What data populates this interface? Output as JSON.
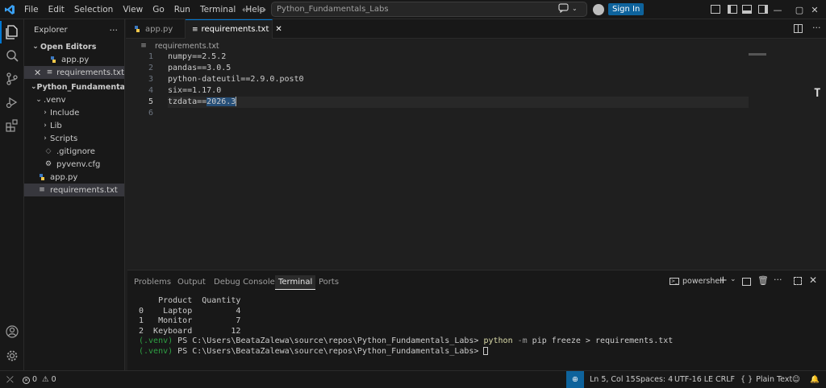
{
  "titlebar": {
    "menus": [
      "File",
      "Edit",
      "Selection",
      "View",
      "Go",
      "Run",
      "Terminal",
      "Help"
    ],
    "search": "Python_Fundamentals_Labs",
    "sign_in": "Sign In"
  },
  "sidebar": {
    "title": "Explorer",
    "open_editors_label": "Open Editors",
    "open_editors": [
      "app.py",
      "requirements.txt"
    ],
    "folder_label": "Python_Fundamentals...",
    "tree": [
      {
        "name": ".venv",
        "kind": "folder-open",
        "indent": 1
      },
      {
        "name": "Include",
        "kind": "folder",
        "indent": 2
      },
      {
        "name": "Lib",
        "kind": "folder",
        "indent": 2
      },
      {
        "name": "Scripts",
        "kind": "folder",
        "indent": 2
      },
      {
        "name": ".gitignore",
        "kind": "file",
        "indent": 2
      },
      {
        "name": "pyvenv.cfg",
        "kind": "gear",
        "indent": 2
      },
      {
        "name": "app.py",
        "kind": "python",
        "indent": 1
      },
      {
        "name": "requirements.txt",
        "kind": "text",
        "indent": 1
      }
    ]
  },
  "tabs": [
    {
      "label": "app.py",
      "active": false
    },
    {
      "label": "requirements.txt",
      "active": true
    }
  ],
  "breadcrumb": "requirements.txt",
  "editor": {
    "lines": [
      {
        "n": "1",
        "text": "numpy==2.5.2"
      },
      {
        "n": "2",
        "text": "pandas==3.0.5"
      },
      {
        "n": "3",
        "text": "python-dateutil==2.9.0.post0"
      },
      {
        "n": "4",
        "text": "six==1.17.0"
      },
      {
        "n": "5",
        "text_a": "tzdata==",
        "text_b": "2026.3"
      },
      {
        "n": "6",
        "text": ""
      }
    ]
  },
  "panel": {
    "tabs": [
      "Problems",
      "Output",
      "Debug Console",
      "Terminal",
      "Ports"
    ],
    "active_tab": "Terminal",
    "shell": "powershell",
    "terminal": {
      "table_header": "    Product  Quantity",
      "rows": [
        "0    Laptop         4",
        "1   Monitor         7",
        "2  Keyboard        12"
      ],
      "prompt_venv": "(.venv)",
      "prompt_path": " PS C:\\Users\\BeataZalewa\\source\\repos\\Python_Fundamentals_Labs> ",
      "cmd_python": "python",
      "cmd_flag": " -m",
      "cmd_rest": " pip freeze > requirements.txt"
    }
  },
  "statusbar": {
    "errors": "0",
    "warnings": "0",
    "position": "Ln 5, Col 15",
    "spaces": "Spaces: 4",
    "encoding": "UTF-16 LE",
    "eol": "CRLF",
    "language": "Plain Text"
  }
}
